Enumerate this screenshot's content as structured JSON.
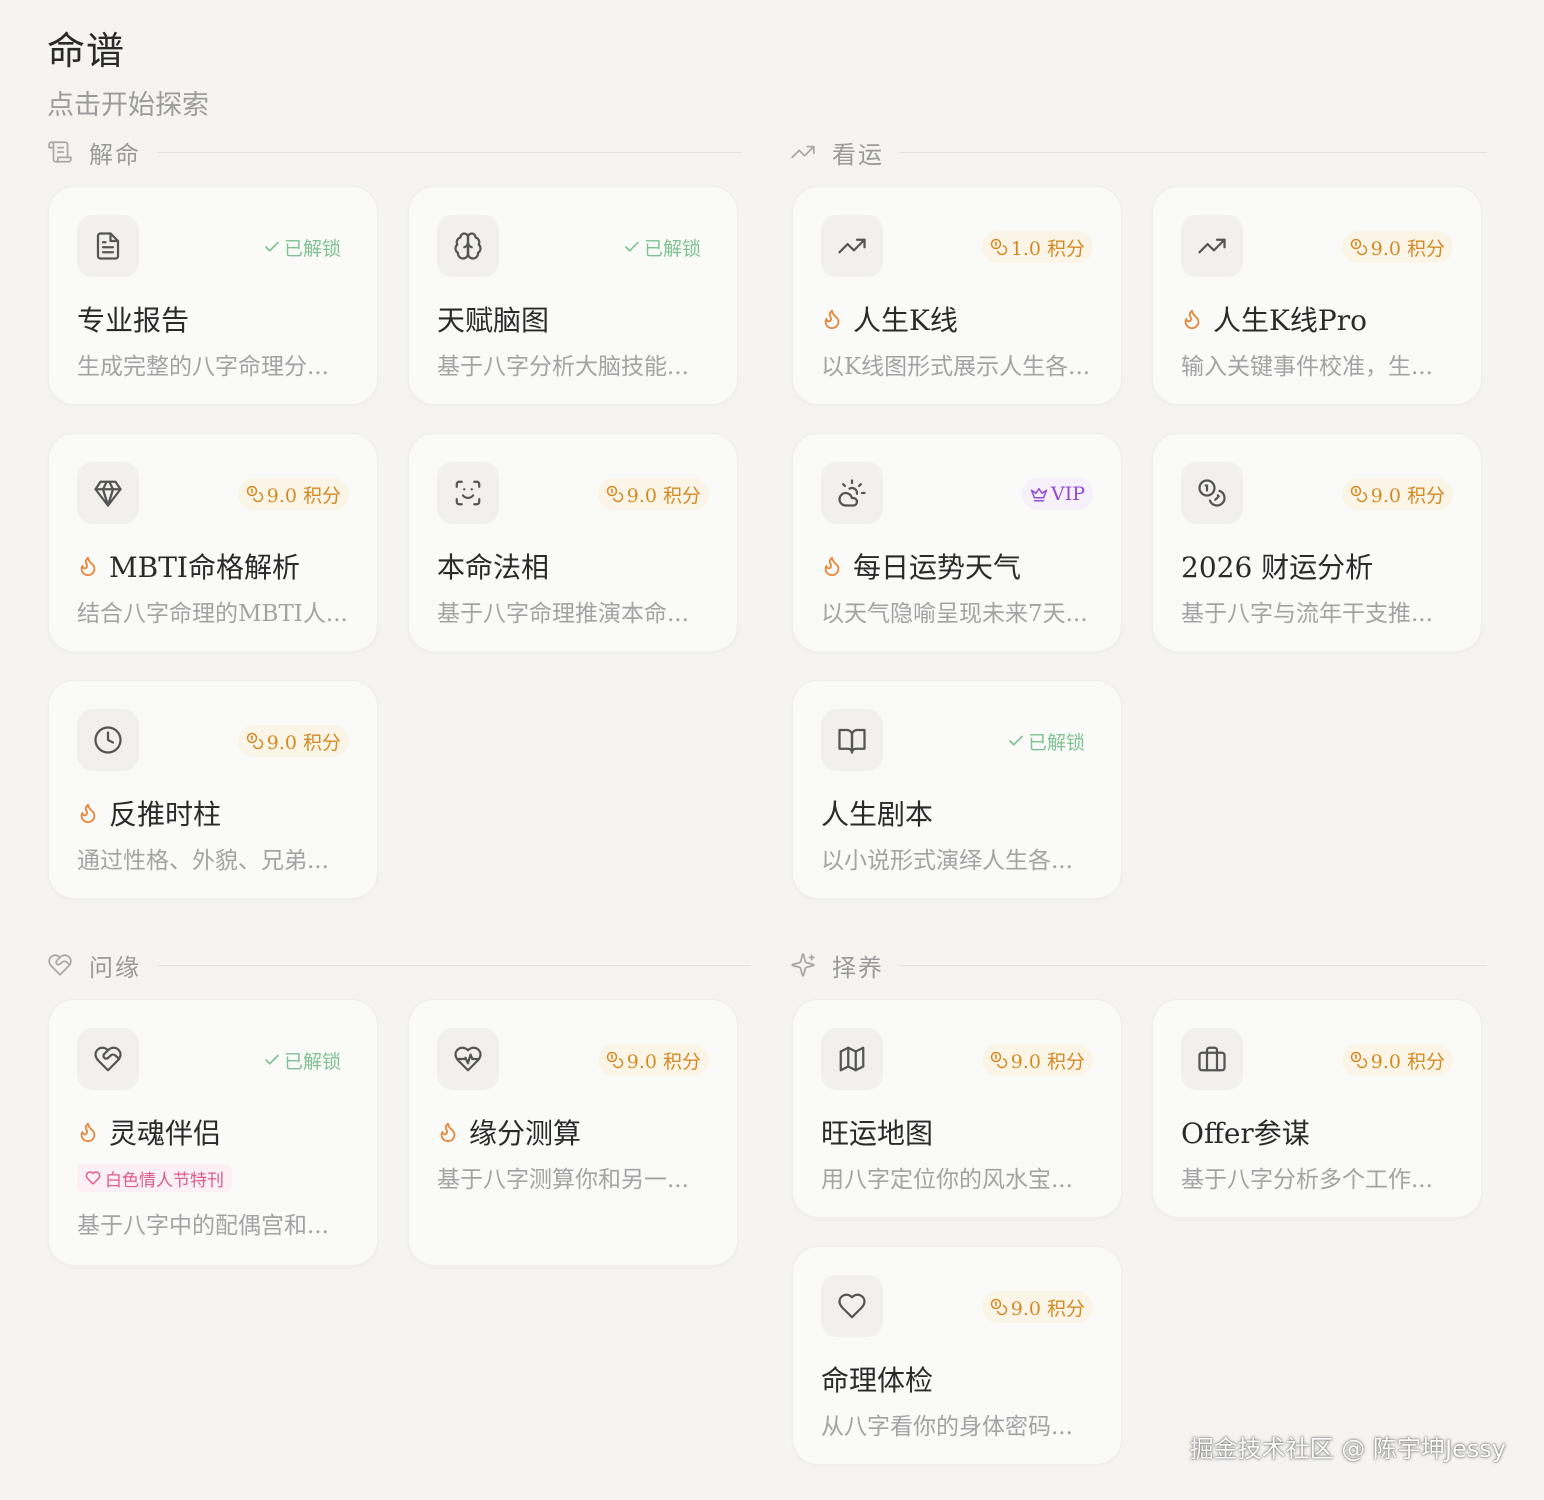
{
  "page": {
    "title": "命谱",
    "subtitle": "点击开始探索"
  },
  "colors": {
    "background": "#f5f4f0",
    "unlocked": "#7fc191",
    "points": "#d48a24",
    "vip": "#8e4ad8",
    "flame": "#e8863a",
    "promo": "#e05a8c"
  },
  "sections": {
    "jieming": {
      "label": "解命",
      "icon": "scroll-icon"
    },
    "kanyun": {
      "label": "看运",
      "icon": "trending-up-icon"
    },
    "wenyuan": {
      "label": "问缘",
      "icon": "heart-handshake-icon"
    },
    "zeyang": {
      "label": "择养",
      "icon": "sparkles-icon"
    }
  },
  "cards": {
    "report": {
      "title": "专业报告",
      "desc": "生成完整的八字命理分...",
      "badge": "已解锁",
      "icon": "document-icon",
      "hot": false
    },
    "talent": {
      "title": "天赋脑图",
      "desc": "基于八字分析大脑技能...",
      "badge": "已解锁",
      "icon": "brain-icon",
      "hot": false
    },
    "mbti": {
      "title": "MBTI命格解析",
      "desc": "结合八字命理的MBTI人...",
      "badge": "9.0 积分",
      "icon": "gem-icon",
      "hot": true
    },
    "faxiang": {
      "title": "本命法相",
      "desc": "基于八字命理推演本命...",
      "badge": "9.0 积分",
      "icon": "face-scan-icon",
      "hot": false
    },
    "shizhu": {
      "title": "反推时柱",
      "desc": "通过性格、外貌、兄弟...",
      "badge": "9.0 积分",
      "icon": "clock-icon",
      "hot": true
    },
    "kline": {
      "title": "人生K线",
      "desc": "以K线图形式展示人生各...",
      "badge": "1.0 积分",
      "icon": "trending-up-icon",
      "hot": true
    },
    "klinepro": {
      "title": "人生K线Pro",
      "desc": "输入关键事件校准，生...",
      "badge": "9.0 积分",
      "icon": "trending-up-icon",
      "hot": true
    },
    "daily": {
      "title": "每日运势天气",
      "desc": "以天气隐喻呈现未来7天...",
      "badge": "VIP",
      "icon": "cloud-sun-icon",
      "hot": true
    },
    "wealth": {
      "title": "2026 财运分析",
      "desc": "基于八字与流年干支推...",
      "badge": "9.0 积分",
      "icon": "coins-icon",
      "hot": false
    },
    "script": {
      "title": "人生剧本",
      "desc": "以小说形式演绎人生各...",
      "badge": "已解锁",
      "icon": "book-open-icon",
      "hot": false
    },
    "soulmate": {
      "title": "灵魂伴侣",
      "desc": "基于八字中的配偶宫和...",
      "badge": "已解锁",
      "promo": "白色情人节特刊",
      "icon": "heart-handshake-icon",
      "hot": true
    },
    "yuanfen": {
      "title": "缘分测算",
      "desc": "基于八字测算你和另一...",
      "badge": "9.0 积分",
      "icon": "heart-pulse-icon",
      "hot": true
    },
    "map": {
      "title": "旺运地图",
      "desc": "用八字定位你的风水宝...",
      "badge": "9.0 积分",
      "icon": "map-icon",
      "hot": false
    },
    "offer": {
      "title": "Offer参谋",
      "desc": "基于八字分析多个工作...",
      "badge": "9.0 积分",
      "icon": "briefcase-icon",
      "hot": false
    },
    "health": {
      "title": "命理体检",
      "desc": "从八字看你的身体密码...",
      "badge": "9.0 积分",
      "icon": "heart-icon",
      "hot": false
    }
  },
  "watermark": "掘金技术社区 @ 陈宇坤Jessy"
}
